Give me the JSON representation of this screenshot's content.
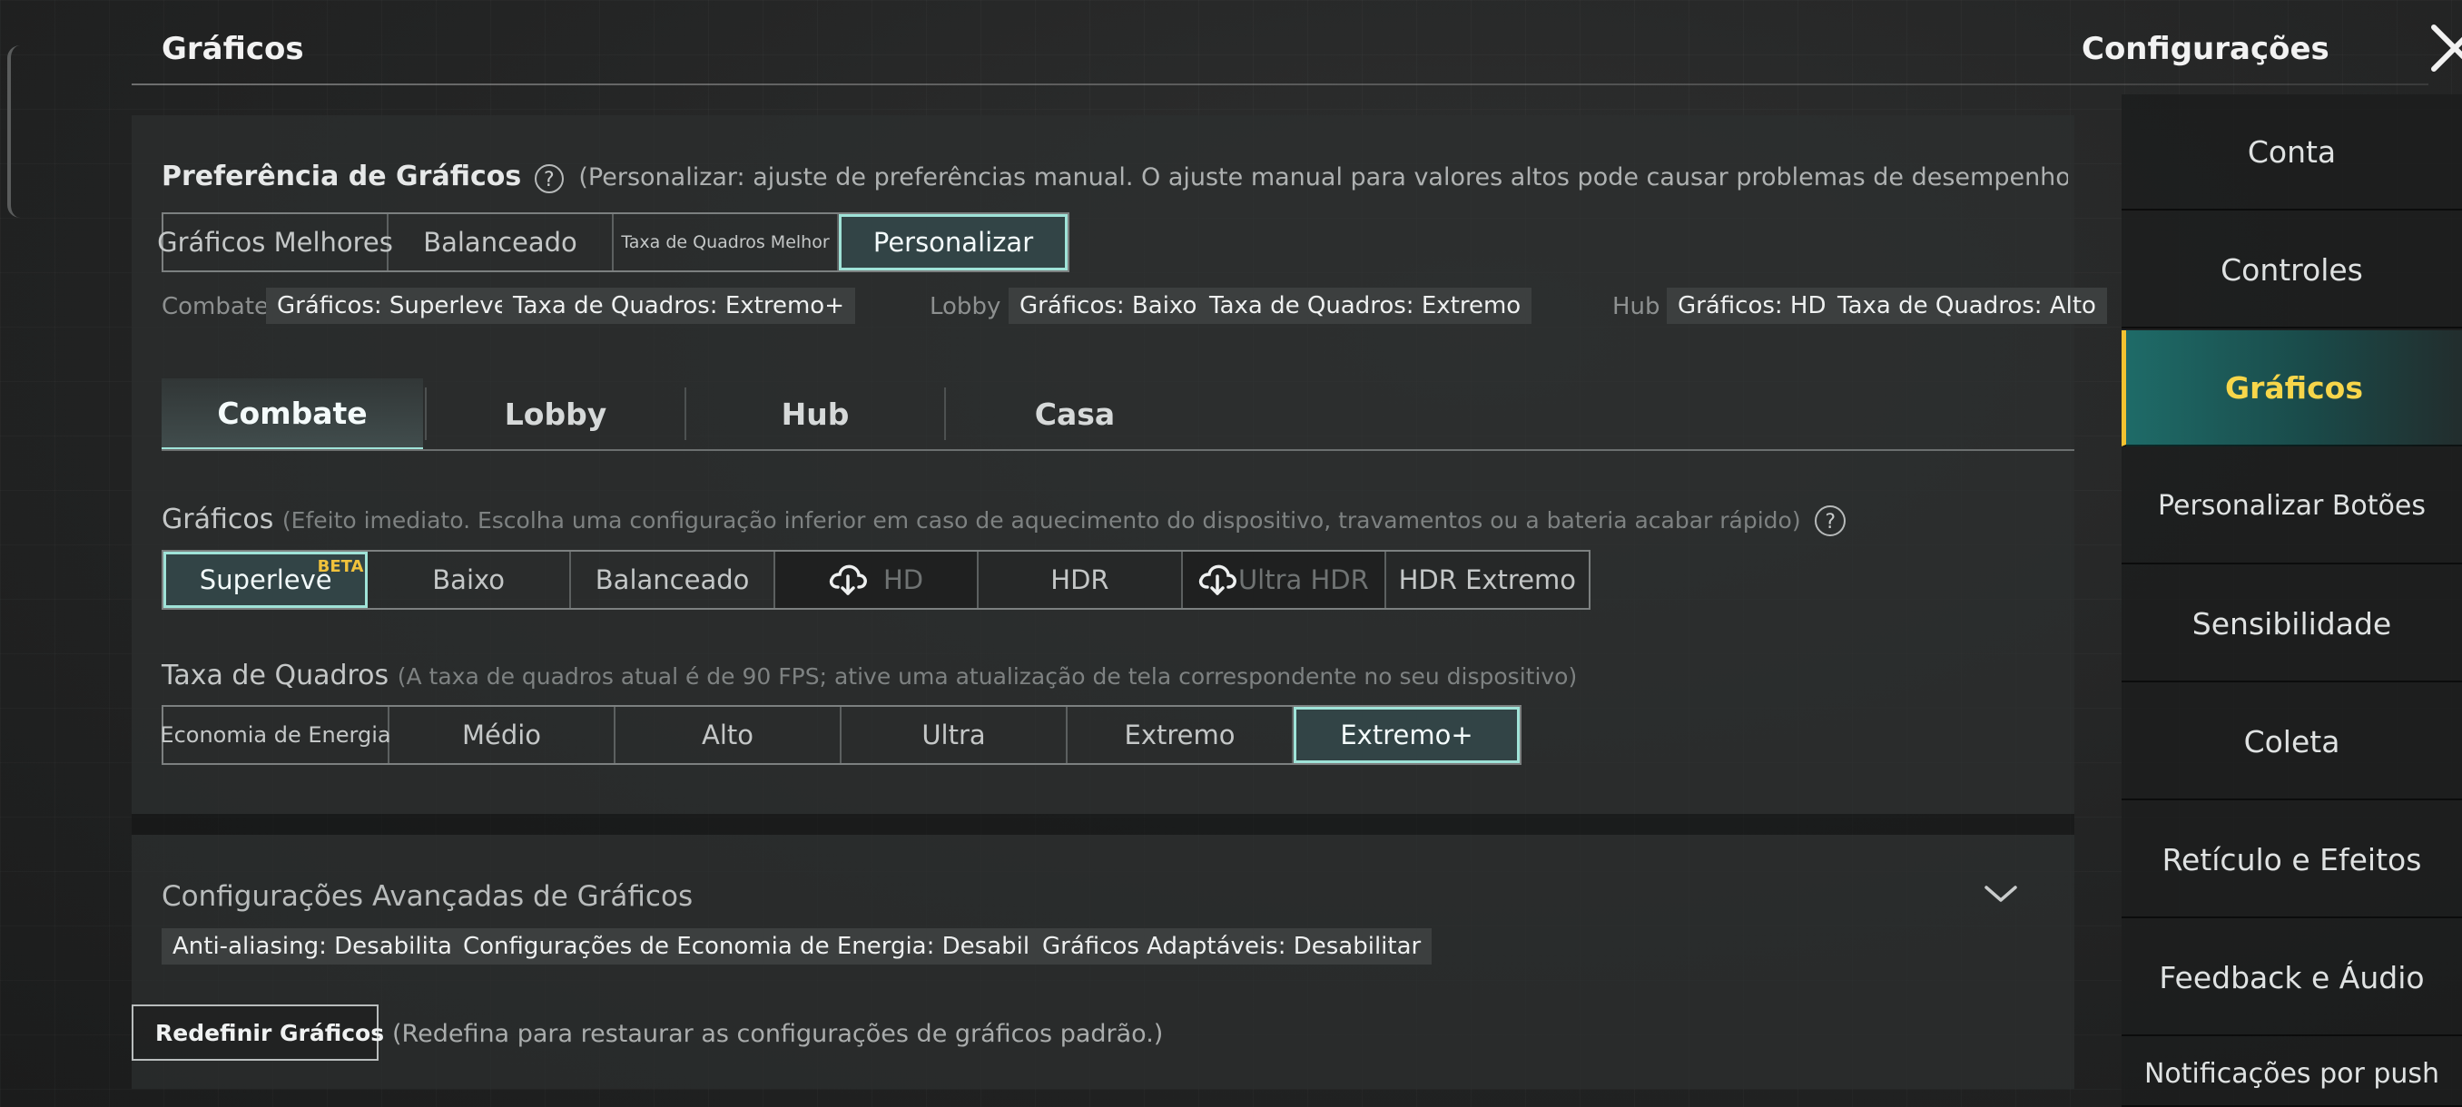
{
  "header": {
    "title": "Gráficos",
    "settings_title": "Configurações"
  },
  "icons": {
    "close": "close-icon",
    "help": "help-icon",
    "download": "cloud-download-icon",
    "expand": "chevron-down-icon",
    "reset": "reset-icon"
  },
  "colors": {
    "accent": "#9fe3d8",
    "active_sidebar_text": "#f7d64a",
    "beta_badge": "#f1c23c"
  },
  "preference": {
    "label": "Preferência de Gráficos",
    "help": "?",
    "description": "(Personalizar: ajuste de preferências manual. O ajuste manual para valores altos pode causar problemas de desempenho, como superaquecimento, m",
    "options": [
      "Gráficos Melhores",
      "Balanceado",
      "Taxa de Quadros Melhor",
      "Personalizar"
    ],
    "selected": "Personalizar"
  },
  "presets": {
    "combat": {
      "label": "Combate",
      "graphics": "Gráficos: Superleve",
      "framerate": "Taxa de Quadros: Extremo+"
    },
    "lobby": {
      "label": "Lobby",
      "graphics": "Gráficos: Baixo",
      "framerate": "Taxa de Quadros: Extremo"
    },
    "hub": {
      "label": "Hub",
      "graphics": "Gráficos: HD",
      "framerate": "Taxa de Quadros: Alto"
    }
  },
  "tabs": [
    "Combate",
    "Lobby",
    "Hub",
    "Casa"
  ],
  "active_tab": "Combate",
  "graphics": {
    "label": "Gráficos",
    "note": "(Efeito imediato. Escolha uma configuração inferior em caso de aquecimento do dispositivo, travamentos ou a bateria acabar rápido)",
    "help": "?",
    "options": [
      "Superleve",
      "Baixo",
      "Balanceado",
      "HD",
      "HDR",
      "Ultra HDR",
      "HDR Extremo"
    ],
    "beta_badge": "BETA",
    "selected": "Superleve"
  },
  "framerate": {
    "label": "Taxa de Quadros",
    "note": "(A taxa de quadros atual é de 90 FPS; ative uma atualização de tela correspondente no seu dispositivo)",
    "options": [
      "Economia de Energia",
      "Médio",
      "Alto",
      "Ultra",
      "Extremo",
      "Extremo+"
    ],
    "selected": "Extremo+"
  },
  "advanced": {
    "title": "Configurações Avançadas de Gráficos",
    "tags": [
      "Anti-aliasing: Desabilitar",
      "Configurações de Economia de Energia: Desabilitar",
      "Gráficos Adaptáveis: Desabilitar"
    ]
  },
  "reset": {
    "label": "Redefinir Gráficos",
    "note": "(Redefina para restaurar as configurações de gráficos padrão.)"
  },
  "sidebar": {
    "items": [
      "Conta",
      "Controles",
      "Gráficos",
      "Personalizar Botões",
      "Sensibilidade",
      "Coleta",
      "Retículo e Efeitos",
      "Feedback e Áudio",
      "Notificações por push"
    ],
    "active": "Gráficos"
  }
}
